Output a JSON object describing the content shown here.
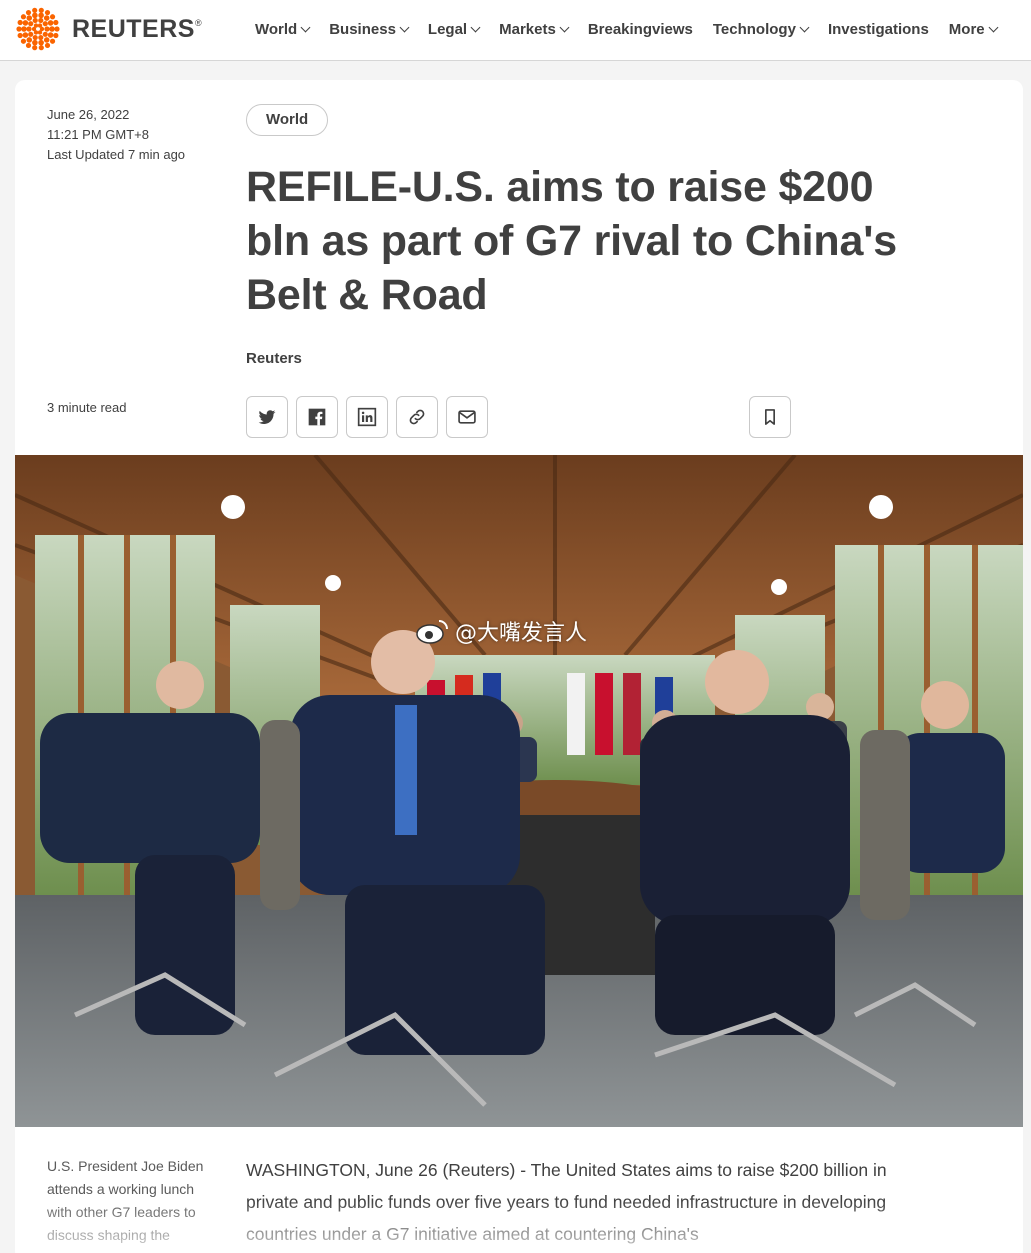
{
  "brand": {
    "name": "REUTERS",
    "registered": "®"
  },
  "nav": {
    "items": [
      {
        "label": "World",
        "dropdown": true
      },
      {
        "label": "Business",
        "dropdown": true
      },
      {
        "label": "Legal",
        "dropdown": true
      },
      {
        "label": "Markets",
        "dropdown": true
      },
      {
        "label": "Breakingviews",
        "dropdown": false
      },
      {
        "label": "Technology",
        "dropdown": true
      },
      {
        "label": "Investigations",
        "dropdown": false
      },
      {
        "label": "More",
        "dropdown": true
      }
    ]
  },
  "article": {
    "date": "June 26, 2022",
    "time": "11:21 PM GMT+8",
    "updated": "Last Updated 7 min ago",
    "section_tag": "World",
    "headline": "REFILE-U.S. aims to raise $200 bln as part of G7 rival to China's Belt & Road",
    "byline": "Reuters",
    "read_time": "3 minute read",
    "share_icons": [
      "twitter-icon",
      "facebook-icon",
      "linkedin-icon",
      "link-icon",
      "email-icon"
    ],
    "bookmark_icon": "bookmark-icon",
    "watermark": "@大嘴发言人",
    "caption": "U.S. President Joe Biden attends a working lunch with other G7 leaders to discuss shaping the",
    "body": "WASHINGTON, June 26 (Reuters) - The United States aims to raise $200 billion in private and public funds over five years to fund needed infrastructure in developing countries under a G7 initiative aimed at countering China's"
  },
  "colors": {
    "brand_orange": "#fa6400",
    "text": "#404040",
    "border": "#c9c9c9"
  }
}
